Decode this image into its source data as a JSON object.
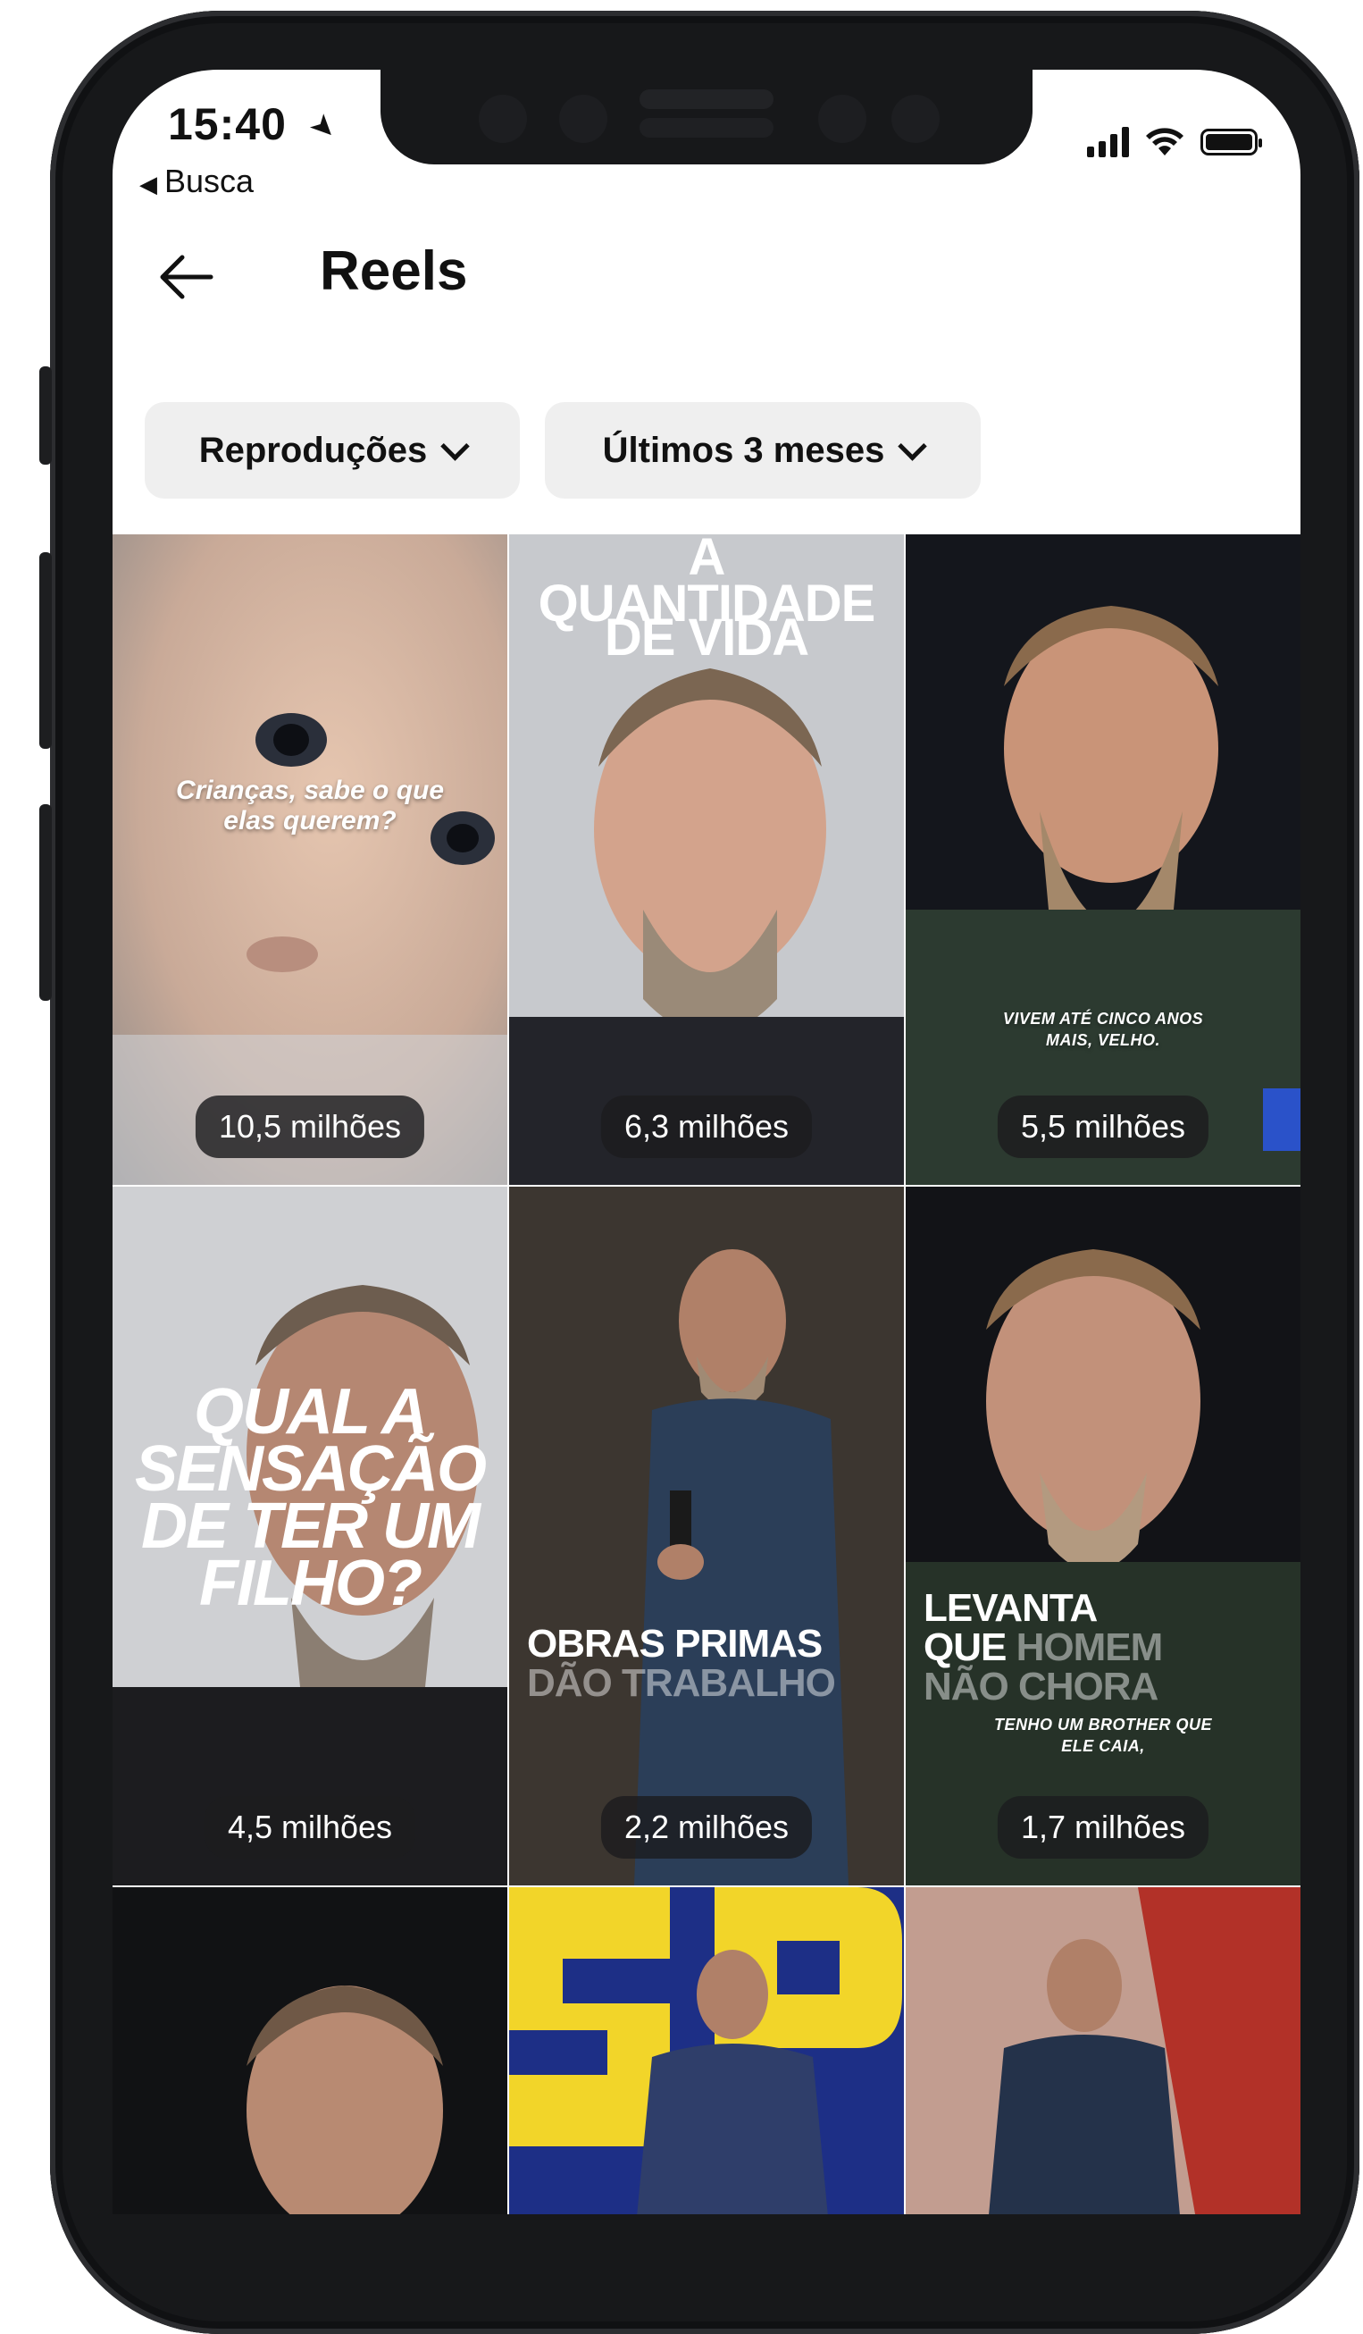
{
  "status_bar": {
    "time": "15:40",
    "back_app": "Busca"
  },
  "header": {
    "title": "Reels"
  },
  "filters": [
    {
      "label": "Reproduções"
    },
    {
      "label": "Últimos 3 meses"
    }
  ],
  "reels": [
    {
      "views": "10,5 milhões",
      "overlay": "Crianças, sabe o que elas querem?"
    },
    {
      "views": "6,3 milhões",
      "overlay_line1": "A",
      "overlay_line2": "QUANTIDADE",
      "overlay_line3": "DE VIDA"
    },
    {
      "views": "5,5 milhões",
      "overlay": "VIVEM ATÉ CINCO ANOS MAIS, VELHO."
    },
    {
      "views": "4,5 milhões",
      "overlay": "QUAL A SENSAÇÃO DE TER UM FILHO?"
    },
    {
      "views": "2,2 milhões",
      "overlay_line1": "OBRAS PRIMAS",
      "overlay_line2": "DÃO TRABALHO"
    },
    {
      "views": "1,7 milhões",
      "overlay_line1": "LEVANTA",
      "overlay_line2a": "QUE",
      "overlay_line2b": "HOMEM",
      "overlay_line3": "NÃO CHORA",
      "caption": "TENHO UM BROTHER QUE ELE CAIA,"
    },
    {
      "views": ""
    },
    {
      "views": ""
    },
    {
      "views": ""
    }
  ],
  "colors": {
    "background": "#ffffff",
    "pill": "#efefef",
    "badge": "#1c1c1e",
    "phone_frame": "#17181a"
  }
}
